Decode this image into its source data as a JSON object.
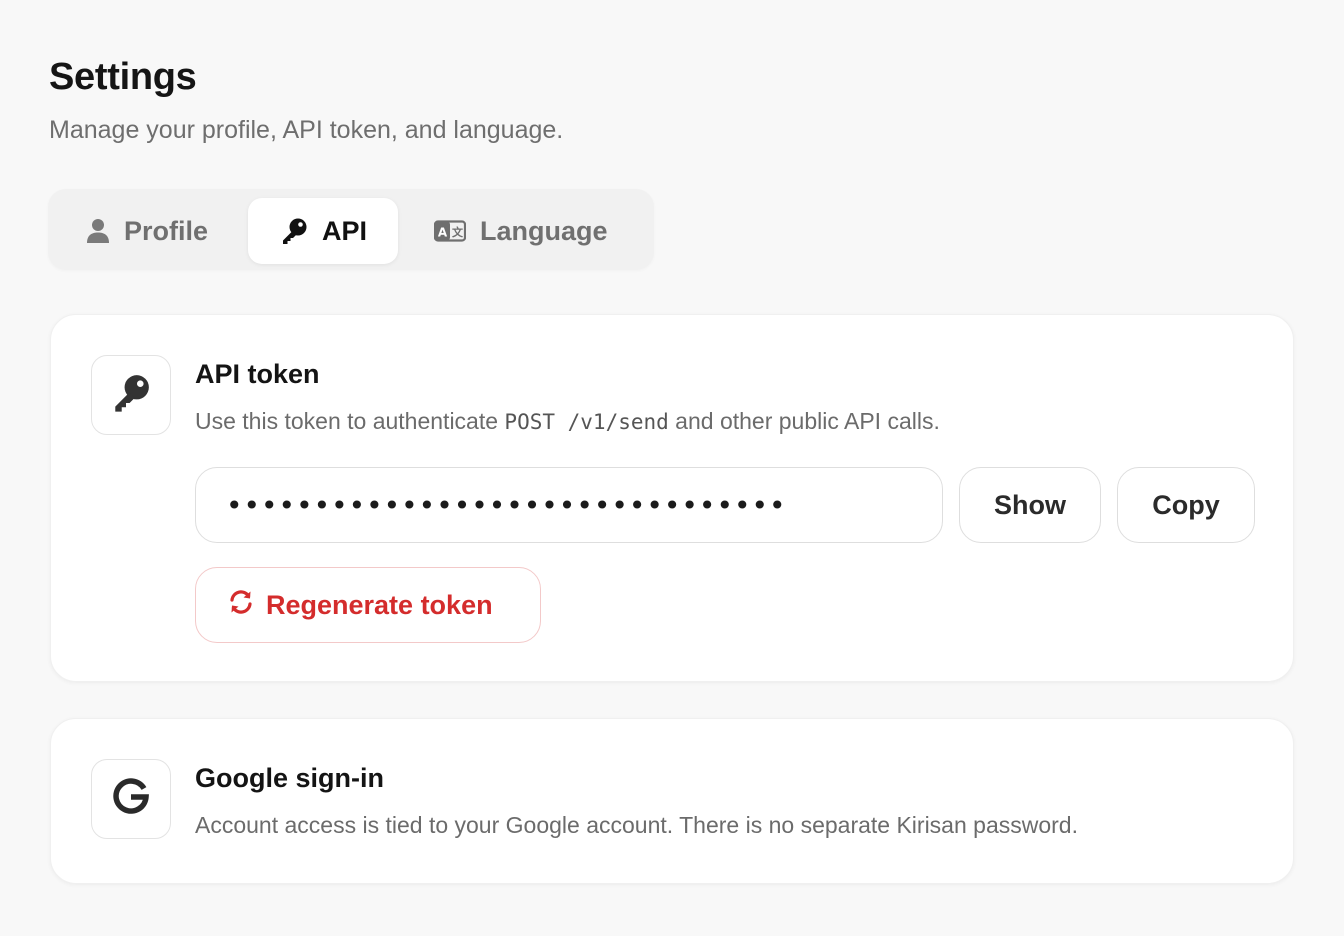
{
  "header": {
    "title": "Settings",
    "subtitle": "Manage your profile, API token, and language."
  },
  "tabs": [
    {
      "label": "Profile",
      "icon": "person-icon",
      "active": false
    },
    {
      "label": "API",
      "icon": "key-icon",
      "active": true
    },
    {
      "label": "Language",
      "icon": "translate-icon",
      "active": false
    }
  ],
  "api_card": {
    "icon": "key-icon",
    "title": "API token",
    "desc_prefix": "Use this token to authenticate ",
    "desc_code": "POST /v1/send",
    "desc_suffix": " and other public API calls.",
    "token_value": "••••••••••••••••••••••••••••••••",
    "show_label": "Show",
    "copy_label": "Copy",
    "regenerate_label": "Regenerate token",
    "regenerate_icon": "refresh-icon"
  },
  "google_card": {
    "icon": "google-g-icon",
    "title": "Google sign-in",
    "desc": "Account access is tied to your Google account. There is no separate Kirisan password."
  },
  "colors": {
    "background": "#f8f8f8",
    "card": "#ffffff",
    "danger": "#d42c2c",
    "danger_border": "#f3c9c9",
    "muted_text": "#6b6b6b"
  }
}
